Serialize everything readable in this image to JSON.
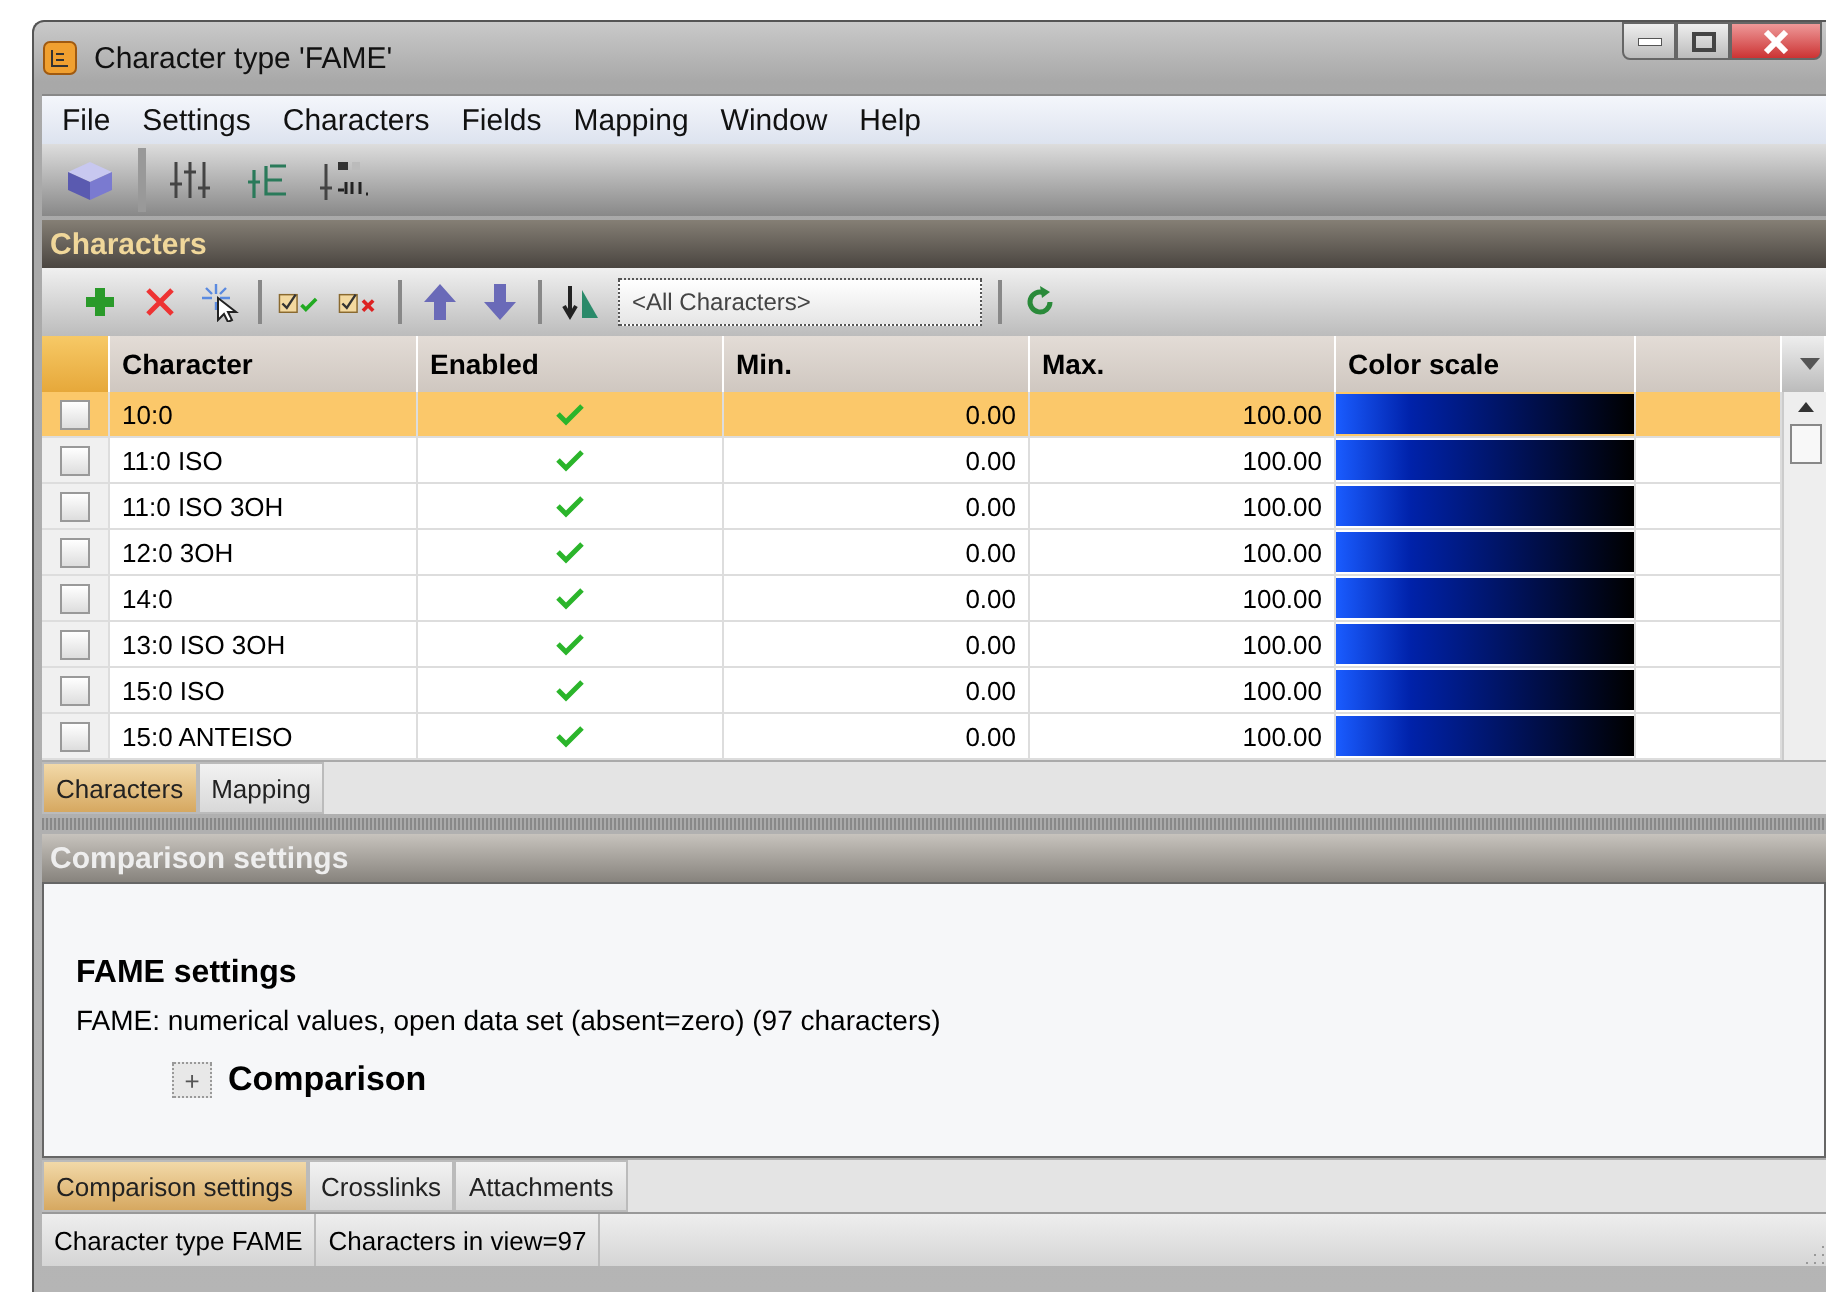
{
  "window": {
    "title": "Character type 'FAME'"
  },
  "menu": [
    "File",
    "Settings",
    "Characters",
    "Fields",
    "Mapping",
    "Window",
    "Help"
  ],
  "characters_panel": {
    "title": "Characters",
    "filter": {
      "value": "<All Characters>"
    }
  },
  "table": {
    "columns": [
      "Character",
      "Enabled",
      "Min.",
      "Max.",
      "Color scale"
    ],
    "rows": [
      {
        "character": "10:0",
        "enabled": true,
        "min": "0.00",
        "max": "100.00",
        "checked": false,
        "selected": true
      },
      {
        "character": "11:0 ISO",
        "enabled": true,
        "min": "0.00",
        "max": "100.00",
        "checked": false,
        "selected": false
      },
      {
        "character": "11:0 ISO 3OH",
        "enabled": true,
        "min": "0.00",
        "max": "100.00",
        "checked": false,
        "selected": false
      },
      {
        "character": "12:0 3OH",
        "enabled": true,
        "min": "0.00",
        "max": "100.00",
        "checked": false,
        "selected": false
      },
      {
        "character": "14:0",
        "enabled": true,
        "min": "0.00",
        "max": "100.00",
        "checked": false,
        "selected": false
      },
      {
        "character": "13:0 ISO 3OH",
        "enabled": true,
        "min": "0.00",
        "max": "100.00",
        "checked": false,
        "selected": false
      },
      {
        "character": "15:0 ISO",
        "enabled": true,
        "min": "0.00",
        "max": "100.00",
        "checked": false,
        "selected": false
      },
      {
        "character": "15:0 ANTEISO",
        "enabled": true,
        "min": "0.00",
        "max": "100.00",
        "checked": false,
        "selected": false
      }
    ]
  },
  "upper_tabs": [
    {
      "label": "Characters",
      "selected": true
    },
    {
      "label": "Mapping",
      "selected": false
    }
  ],
  "comparison_panel": {
    "title": "Comparison settings",
    "heading": "FAME settings",
    "description": "FAME: numerical values, open data set (absent=zero) (97 characters)",
    "node": {
      "toggle": "+",
      "label": "Comparison"
    }
  },
  "lower_tabs": [
    {
      "label": "Comparison settings",
      "selected": true
    },
    {
      "label": "Crosslinks",
      "selected": false
    },
    {
      "label": "Attachments",
      "selected": false
    }
  ],
  "status_bar": [
    "Character type FAME",
    "Characters in view=97"
  ]
}
